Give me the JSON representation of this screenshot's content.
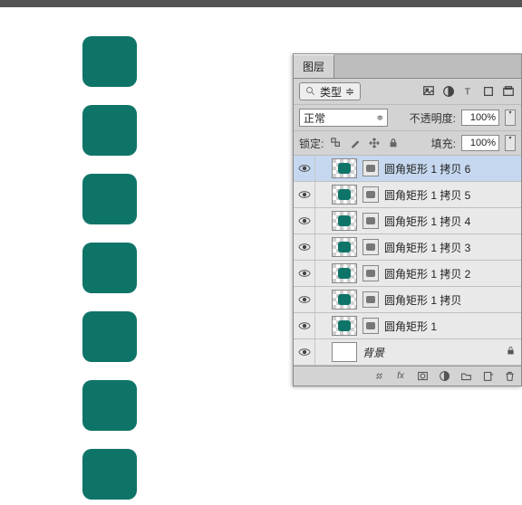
{
  "panel": {
    "title": "图层",
    "filter_label": "类型",
    "blend_mode": "正常",
    "opacity_label": "不透明度:",
    "opacity_value": "100%",
    "lock_label": "锁定:",
    "fill_label": "填充:",
    "fill_value": "100%"
  },
  "layers": [
    {
      "name": "圆角矩形 1 拷贝 6",
      "selected": true,
      "type": "shape"
    },
    {
      "name": "圆角矩形 1 拷贝 5",
      "selected": false,
      "type": "shape"
    },
    {
      "name": "圆角矩形 1 拷贝 4",
      "selected": false,
      "type": "shape"
    },
    {
      "name": "圆角矩形 1 拷贝 3",
      "selected": false,
      "type": "shape"
    },
    {
      "name": "圆角矩形 1 拷贝 2",
      "selected": false,
      "type": "shape"
    },
    {
      "name": "圆角矩形 1 拷贝",
      "selected": false,
      "type": "shape"
    },
    {
      "name": "圆角矩形 1",
      "selected": false,
      "type": "shape"
    },
    {
      "name": "背景",
      "selected": false,
      "type": "bg",
      "locked": true
    }
  ],
  "shapes_on_canvas": 7,
  "shape_color": "#0f7468"
}
